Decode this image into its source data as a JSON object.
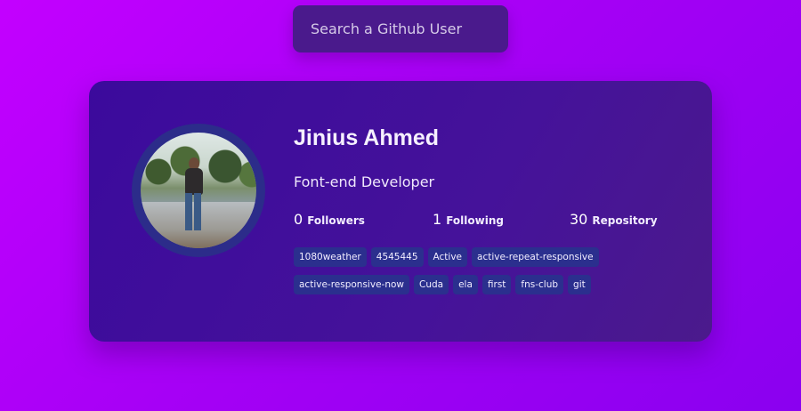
{
  "search": {
    "placeholder": "Search a Github User",
    "value": ""
  },
  "profile": {
    "name": "Jinius Ahmed",
    "bio": "Font-end Developer",
    "avatar_alt": "avatar",
    "stats": [
      {
        "value": "0",
        "label": "Followers"
      },
      {
        "value": "1",
        "label": "Following"
      },
      {
        "value": "30",
        "label": "Repository"
      }
    ],
    "repos": [
      "1080weather",
      "4545445",
      "Active",
      "active-repeat-responsive",
      "active-responsive-now",
      "Cuda",
      "ela",
      "first",
      "fns-club",
      "git"
    ]
  },
  "colors": {
    "background_start": "#c300ff",
    "background_end": "#8a00f0",
    "card": "#3b0a9c",
    "search_box": "#4a1a8c",
    "repo_chip": "#2b2f8e",
    "avatar_ring": "#2c2c8a"
  }
}
